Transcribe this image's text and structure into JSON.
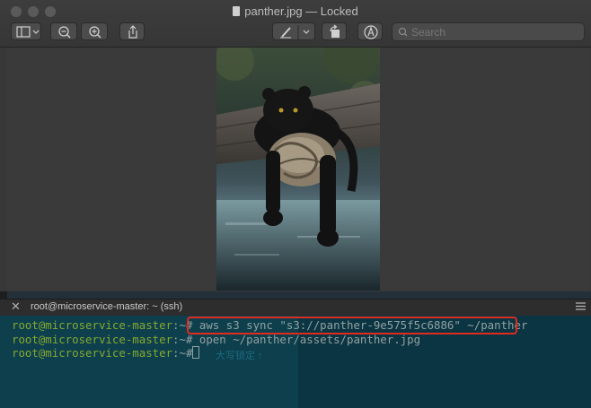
{
  "preview": {
    "title": "panther.jpg — Locked",
    "search_placeholder": "Search"
  },
  "terminal": {
    "tab_title": "root@microservice-master: ~ (ssh)",
    "lines": [
      {
        "prompt": "root@microservice-master",
        "sep": ":~# ",
        "command": "aws s3 sync \"s3://panther-9e575f5c6886\" ~/panther"
      },
      {
        "prompt": "root@microservice-master",
        "sep": ":~# ",
        "command": "open ~/panther/assets/panther.jpg"
      },
      {
        "prompt": "root@microservice-master",
        "sep": ":~# ",
        "command": ""
      }
    ],
    "ime_hint": "大写锁定 ↑"
  },
  "colors": {
    "prompt": "#86a92f",
    "highlight": "#e02b1f",
    "terminal_bg": "#0d3f4d"
  },
  "icons": [
    "sidebar-icon",
    "zoom-out-icon",
    "zoom-in-icon",
    "share-icon",
    "markup-pen-icon",
    "rotate-icon",
    "annotate-icon",
    "search-icon",
    "close-icon",
    "menu-icon"
  ]
}
